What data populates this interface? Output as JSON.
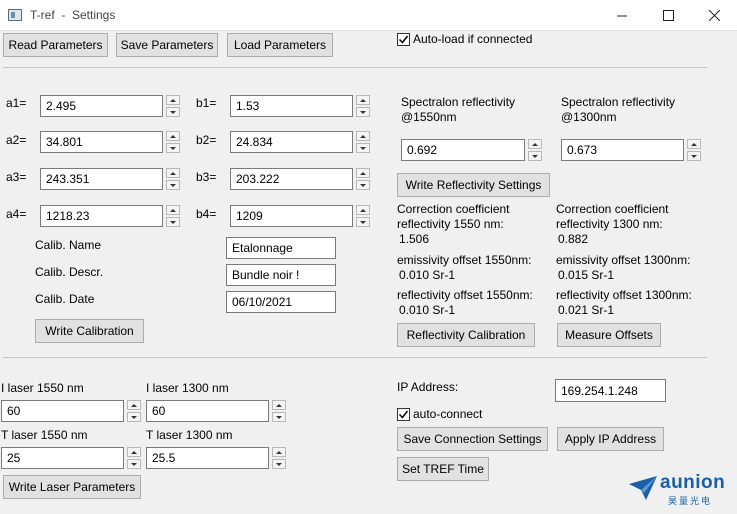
{
  "window": {
    "title": "T-ref  -  Settings"
  },
  "toolbar": {
    "read_label": "Read Parameters",
    "save_label": "Save Parameters",
    "load_label": "Load Parameters",
    "autoload_label": "Auto-load if connected",
    "autoload_checked": true
  },
  "calibration": {
    "a1_label": "a1=",
    "a1_value": "2.495",
    "a2_label": "a2=",
    "a2_value": "34.801",
    "a3_label": "a3=",
    "a3_value": "243.351",
    "a4_label": "a4=",
    "a4_value": "1218.23",
    "b1_label": "b1=",
    "b1_value": "1.53",
    "b2_label": "b2=",
    "b2_value": "24.834",
    "b3_label": "b3=",
    "b3_value": "203.222",
    "b4_label": "b4=",
    "b4_value": "1209",
    "name_label": "Calib. Name",
    "name_value": "Etalonnage",
    "descr_label": "Calib. Descr.",
    "descr_value": "Bundle noir !",
    "date_label": "Calib. Date",
    "date_value": "06/10/2021",
    "write_label": "Write Calibration"
  },
  "reflectivity": {
    "spec1550_label": "Spectralon reflectivity @1550nm",
    "spec1550_value": "0.692",
    "spec1300_label": "Spectralon reflectivity @1300nm",
    "spec1300_value": "0.673",
    "write_label": "Write Reflectivity Settings",
    "cc1550_label": "Correction coefficient reflectivity 1550 nm:",
    "cc1550_value": "1.506",
    "cc1300_label": "Correction coefficient reflectivity 1300 nm:",
    "cc1300_value": "0.882",
    "eo1550_label": "emissivity offset 1550nm:",
    "eo1550_value": "0.010 Sr-1",
    "eo1300_label": "emissivity offset 1300nm:",
    "eo1300_value": "0.015 Sr-1",
    "ro1550_label": "reflectivity offset 1550nm:",
    "ro1550_value": "0.010 Sr-1",
    "ro1300_label": "reflectivity offset 1300nm:",
    "ro1300_value": "0.021 Sr-1",
    "calib_button": "Reflectivity Calibration",
    "measure_button": "Measure Offsets"
  },
  "laser": {
    "i1550_label": "I laser 1550 nm",
    "i1550_value": "60",
    "i1300_label": "I laser 1300 nm",
    "i1300_value": "60",
    "t1550_label": "T laser 1550 nm",
    "t1550_value": "25",
    "t1300_label": "T laser 1300 nm",
    "t1300_value": "25.5",
    "write_label": "Write Laser Parameters"
  },
  "connection": {
    "ip_label": "IP Address:",
    "ip_value": "169.254.1.248",
    "autoconnect_label": "auto-connect",
    "autoconnect_checked": true,
    "save_label": "Save Connection Settings",
    "apply_label": "Apply IP Address",
    "tref_time_label": "Set TREF Time"
  },
  "logo": {
    "brand": "aunion",
    "subtitle": "昊量光电",
    "color": "#1a5fa8"
  }
}
